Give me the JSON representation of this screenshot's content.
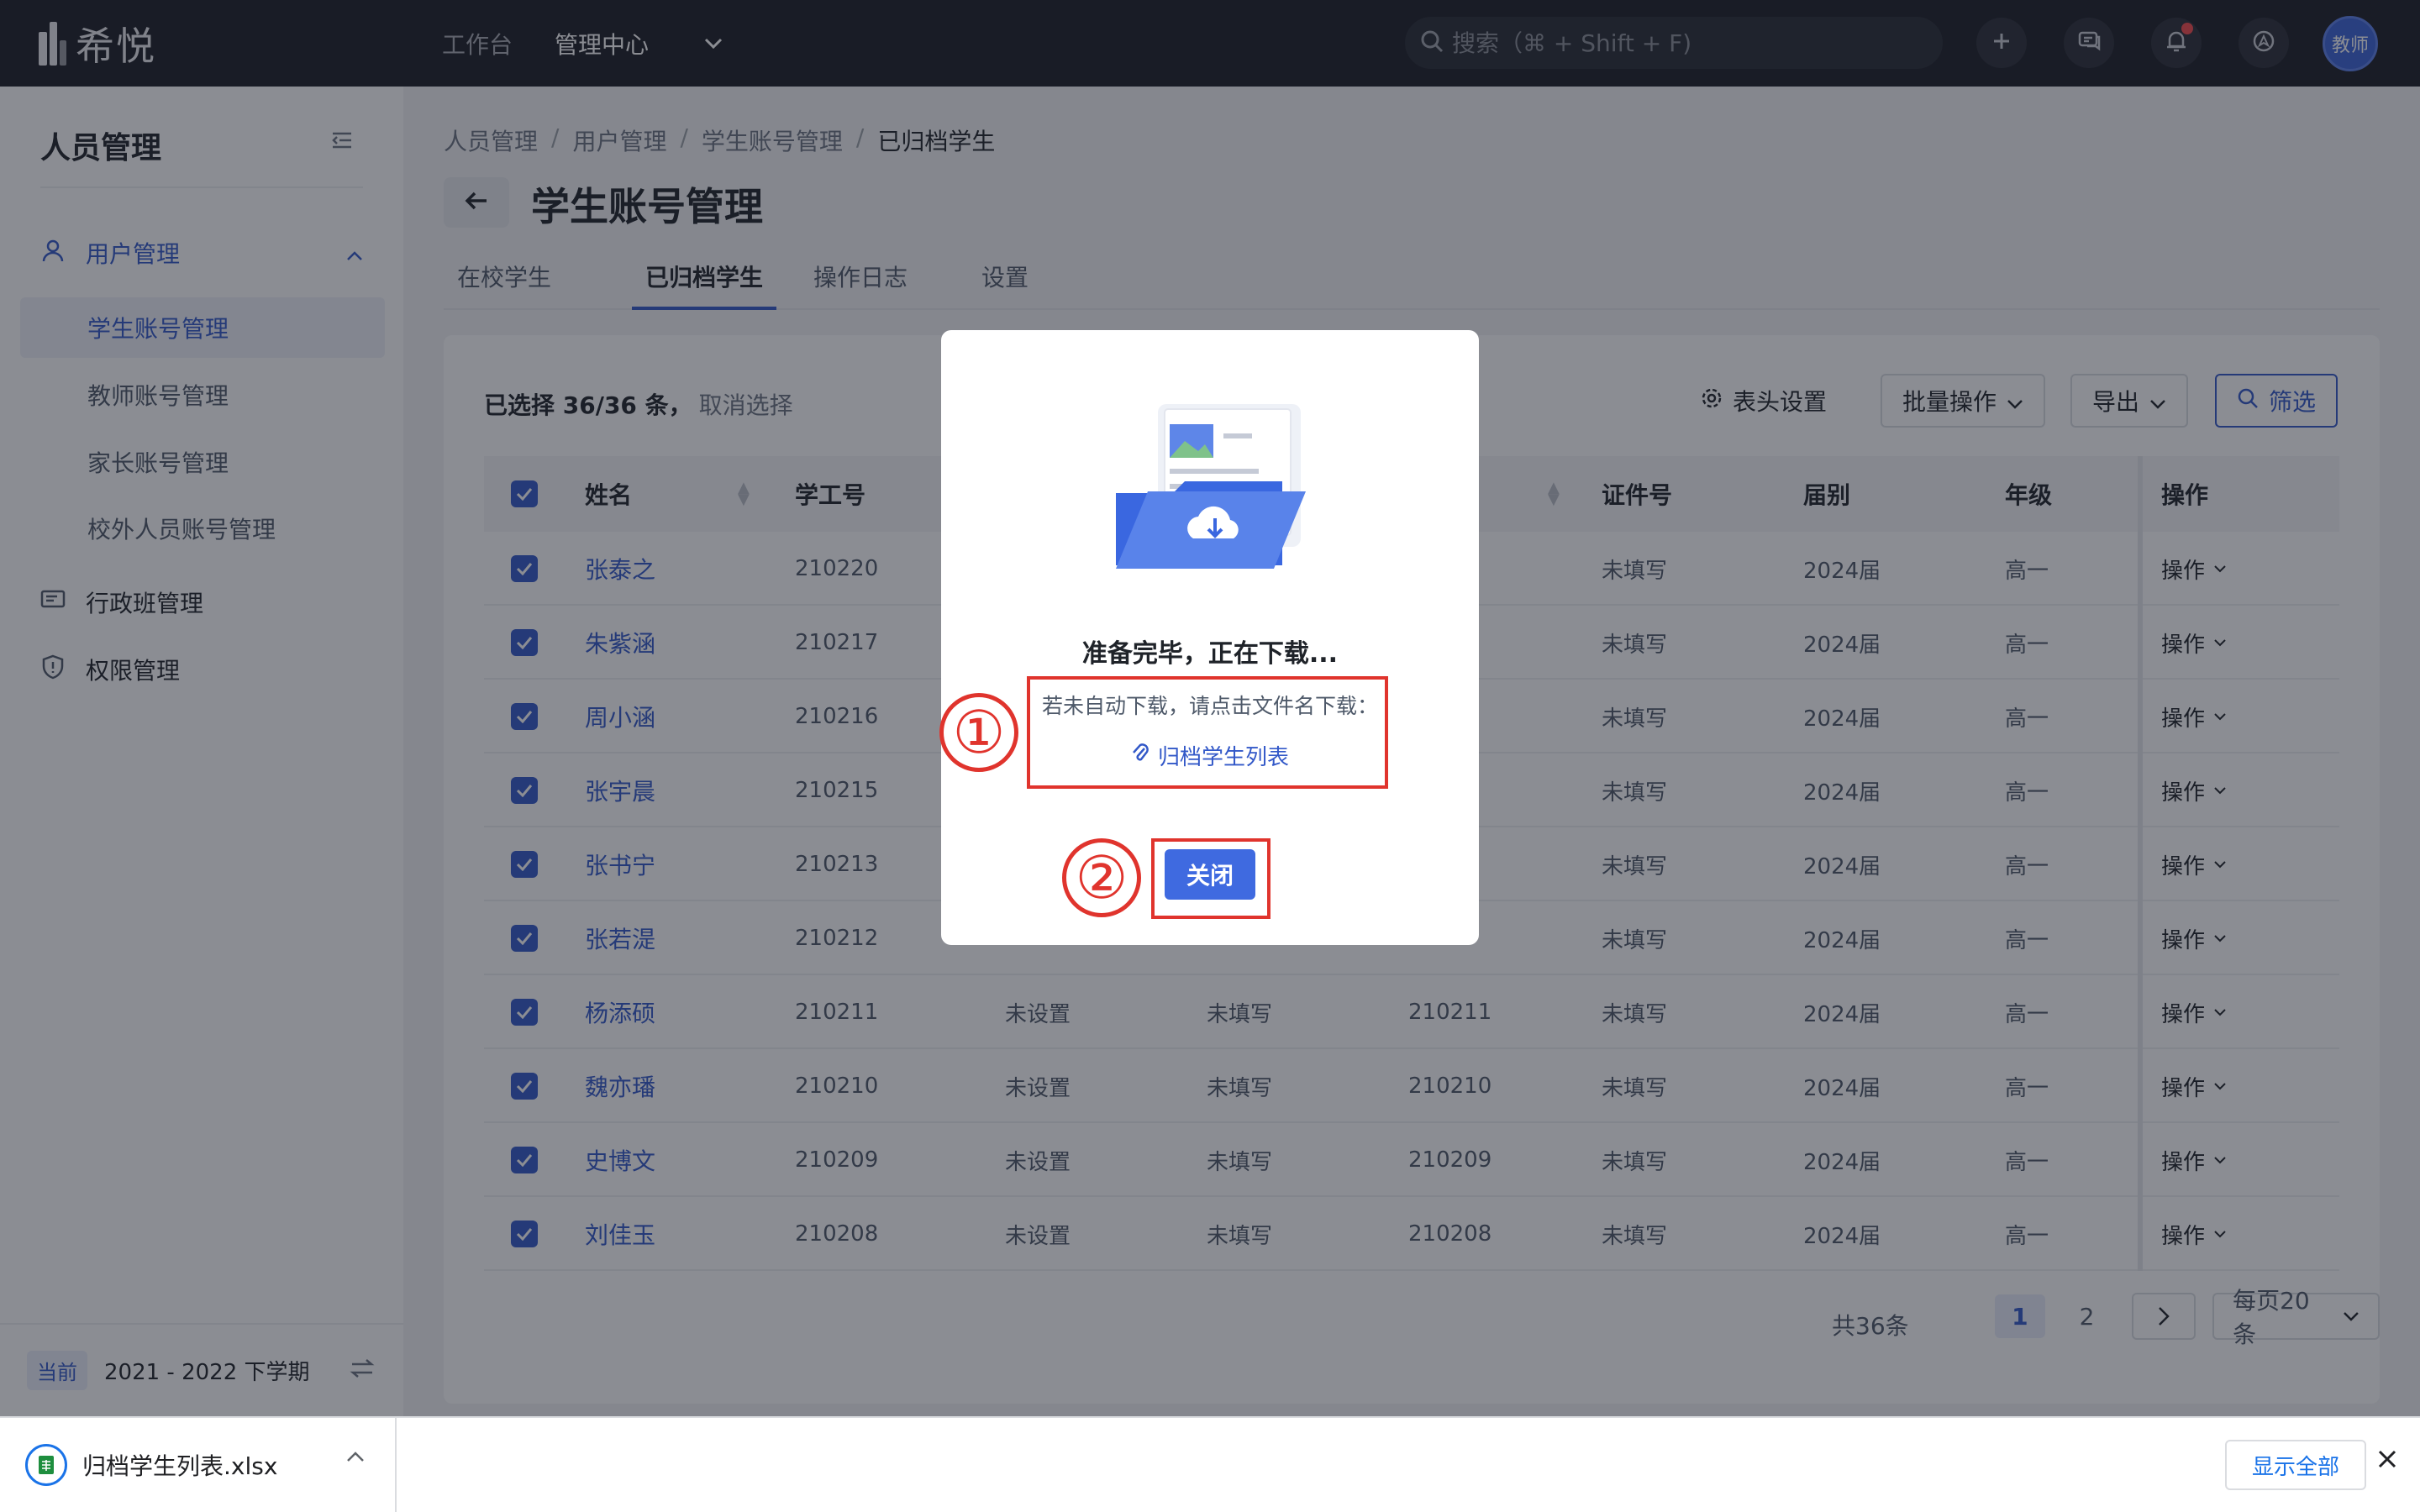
{
  "app": {
    "logo_text": "希悦",
    "nav": [
      {
        "label": "工作台"
      },
      {
        "label": "管理中心"
      }
    ],
    "search_placeholder": "搜索（⌘ + Shift + F)",
    "avatar_text": "教师"
  },
  "sidebar": {
    "title": "人员管理",
    "groups": [
      {
        "label": "用户管理",
        "icon": "user-icon"
      },
      {
        "label": "行政班管理",
        "icon": "class-icon"
      },
      {
        "label": "权限管理",
        "icon": "shield-icon"
      }
    ],
    "sub_items": [
      {
        "label": "学生账号管理"
      },
      {
        "label": "教师账号管理"
      },
      {
        "label": "家长账号管理"
      },
      {
        "label": "校外人员账号管理"
      }
    ],
    "term_tag": "当前",
    "term_text": "2021 - 2022 下学期"
  },
  "page": {
    "breadcrumbs": [
      "人员管理",
      "用户管理",
      "学生账号管理",
      "已归档学生"
    ],
    "breadcrumb_sep": "/",
    "title": "学生账号管理",
    "tabs": [
      "在校学生",
      "已归档学生",
      "操作日志",
      "设置"
    ]
  },
  "toolbar": {
    "selected_text": "已选择 36/36 条，",
    "cancel_select": "取消选择",
    "column_settings": "表头设置",
    "batch": "批量操作",
    "export": "导出",
    "filter": "筛选"
  },
  "table": {
    "headers": [
      "姓名",
      "学工号",
      "",
      "",
      "",
      "证件号",
      "届别",
      "年级",
      "操作"
    ],
    "rows": [
      {
        "name": "张泰之",
        "id": "210220",
        "c3": "",
        "c4": "",
        "c5": "",
        "cert": "未填写",
        "cohort": "2024届",
        "grade": "高一",
        "op": "操作"
      },
      {
        "name": "朱紫涵",
        "id": "210217",
        "c3": "",
        "c4": "",
        "c5": "",
        "cert": "未填写",
        "cohort": "2024届",
        "grade": "高一",
        "op": "操作"
      },
      {
        "name": "周小涵",
        "id": "210216",
        "c3": "",
        "c4": "",
        "c5": "",
        "cert": "未填写",
        "cohort": "2024届",
        "grade": "高一",
        "op": "操作"
      },
      {
        "name": "张宇晨",
        "id": "210215",
        "c3": "",
        "c4": "",
        "c5": "",
        "cert": "未填写",
        "cohort": "2024届",
        "grade": "高一",
        "op": "操作"
      },
      {
        "name": "张书宁",
        "id": "210213",
        "c3": "",
        "c4": "",
        "c5": "",
        "cert": "未填写",
        "cohort": "2024届",
        "grade": "高一",
        "op": "操作"
      },
      {
        "name": "张若湜",
        "id": "210212",
        "c3": "",
        "c4": "",
        "c5": "",
        "cert": "未填写",
        "cohort": "2024届",
        "grade": "高一",
        "op": "操作"
      },
      {
        "name": "杨添硕",
        "id": "210211",
        "c3": "未设置",
        "c4": "未填写",
        "c5": "210211",
        "cert": "未填写",
        "cohort": "2024届",
        "grade": "高一",
        "op": "操作"
      },
      {
        "name": "魏亦璠",
        "id": "210210",
        "c3": "未设置",
        "c4": "未填写",
        "c5": "210210",
        "cert": "未填写",
        "cohort": "2024届",
        "grade": "高一",
        "op": "操作"
      },
      {
        "name": "史博文",
        "id": "210209",
        "c3": "未设置",
        "c4": "未填写",
        "c5": "210209",
        "cert": "未填写",
        "cohort": "2024届",
        "grade": "高一",
        "op": "操作"
      },
      {
        "name": "刘佳玉",
        "id": "210208",
        "c3": "未设置",
        "c4": "未填写",
        "c5": "210208",
        "cert": "未填写",
        "cohort": "2024届",
        "grade": "高一",
        "op": "操作"
      }
    ]
  },
  "pagination": {
    "total": "共36条",
    "pages": [
      "1",
      "2"
    ],
    "current_page": "1",
    "page_size": "每页20条"
  },
  "modal": {
    "title": "准备完毕，正在下载...",
    "hint": "若未自动下载，请点击文件名下载：",
    "file_link": "归档学生列表",
    "close": "关闭",
    "annotations": [
      "①",
      "②"
    ]
  },
  "download_bar": {
    "file_name": "归档学生列表.xlsx",
    "show_all": "显示全部"
  },
  "colors": {
    "accent": "#3258c8",
    "topbar": "#1b1d24",
    "annotation_red": "#e0342d"
  }
}
